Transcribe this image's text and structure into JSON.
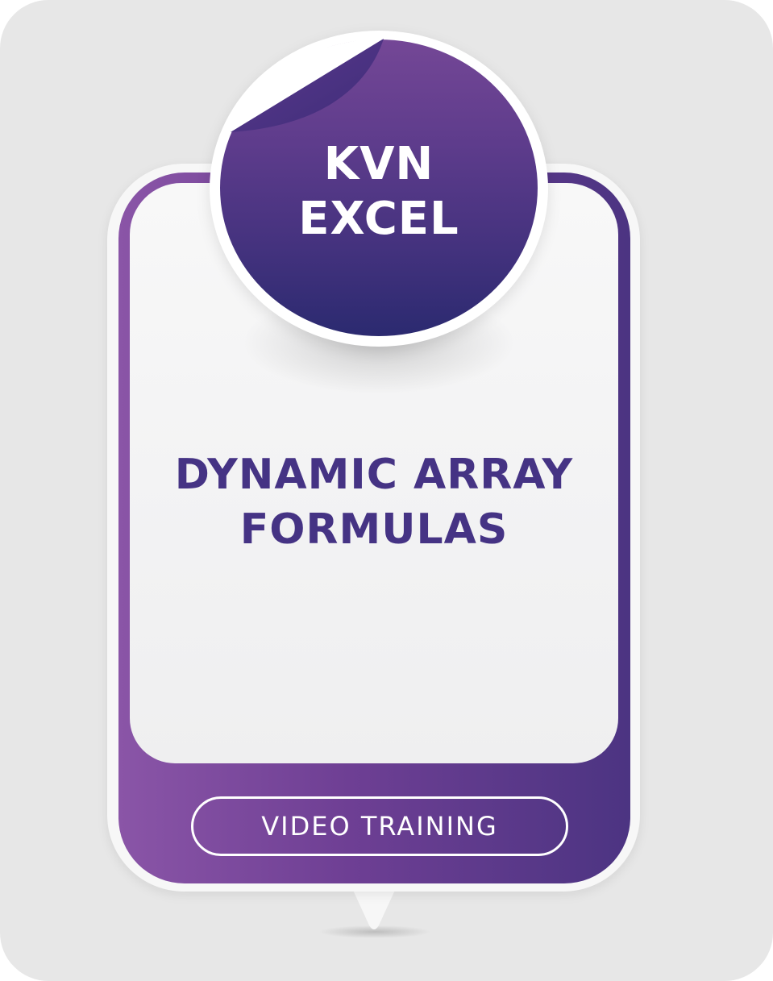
{
  "badge": {
    "line1": "KVN",
    "line2": "EXCEL"
  },
  "title": {
    "line1": "DYNAMIC ARRAY",
    "line2": "FORMULAS"
  },
  "cta": {
    "label": "VIDEO TRAINING"
  },
  "colors": {
    "page_background": "#e7e7e7",
    "frame_left": "#8a55a7",
    "frame_right": "#4c3482",
    "badge_top": "#744796",
    "badge_bottom": "#2b2a70",
    "title_text": "#453384",
    "panel": "#f4f4f5"
  }
}
